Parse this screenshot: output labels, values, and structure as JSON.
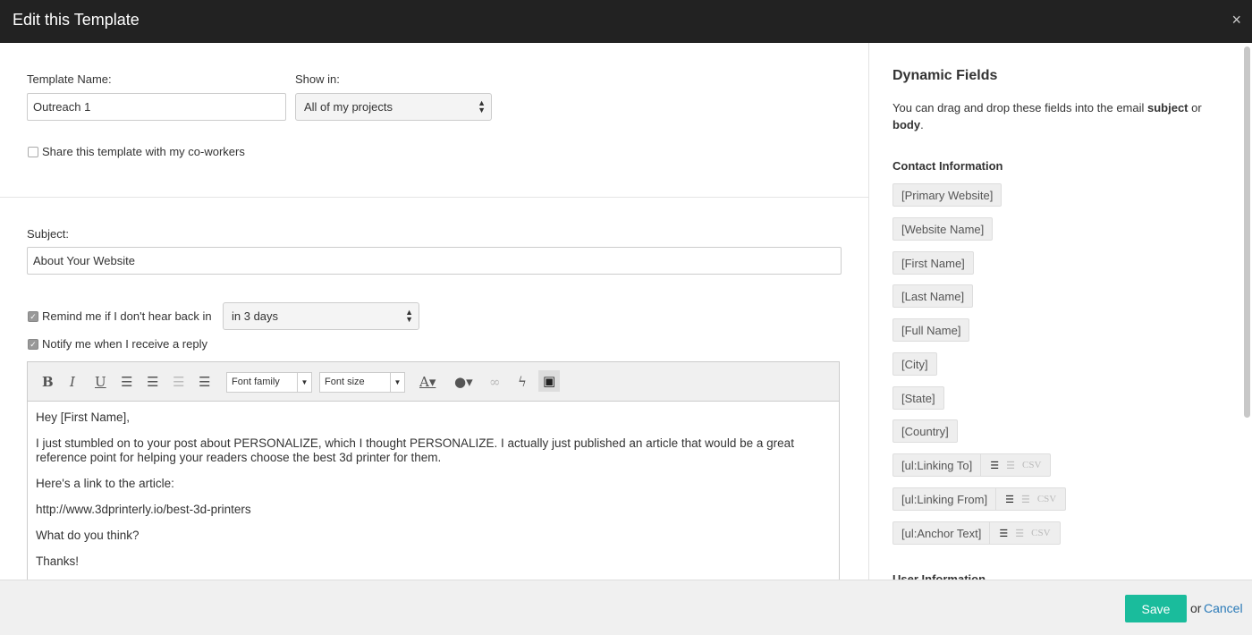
{
  "header": {
    "title": "Edit this Template",
    "close": "×"
  },
  "form": {
    "template_name_label": "Template Name:",
    "template_name": "Outreach 1",
    "show_in_label": "Show in:",
    "show_in": "All of my projects",
    "share_label": "Share this template with my co-workers",
    "subject_label": "Subject:",
    "subject": "About Your Website",
    "remind_label": "Remind me if I don't hear back in",
    "remind_value": "in 3 days",
    "notify_label": "Notify me when I receive a reply"
  },
  "toolbar": {
    "bold": "B",
    "italic": "I",
    "underline": "U",
    "font_family": "Font family",
    "font_size": "Font size"
  },
  "body": [
    "Hey [First Name],",
    "I just stumbled on to your post about PERSONALIZE, which I thought PERSONALIZE. I actually just published an article that would be a great reference point for helping your readers choose the best 3d printer for them.",
    "Here's a link to the article:",
    "http://www.3dprinterly.io/best-3d-printers",
    "What do you think?",
    "Thanks!"
  ],
  "dynamic": {
    "title": "Dynamic Fields",
    "desc_pre": "You can drag and drop these fields into the email ",
    "desc_b1": "subject",
    "desc_mid": " or ",
    "desc_b2": "body",
    "desc_post": ".",
    "contact_title": "Contact Information",
    "fields": [
      "[Primary Website]",
      "[Website Name]",
      "[First Name]",
      "[Last Name]",
      "[Full Name]",
      "[City]",
      "[State]",
      "[Country]"
    ],
    "list_fields": [
      "[ul:Linking To]",
      "[ul:Linking From]",
      "[ul:Anchor Text]"
    ],
    "csv": "CSV",
    "user_title": "User Information"
  },
  "footer": {
    "save": "Save",
    "or": "or",
    "cancel": "Cancel"
  }
}
